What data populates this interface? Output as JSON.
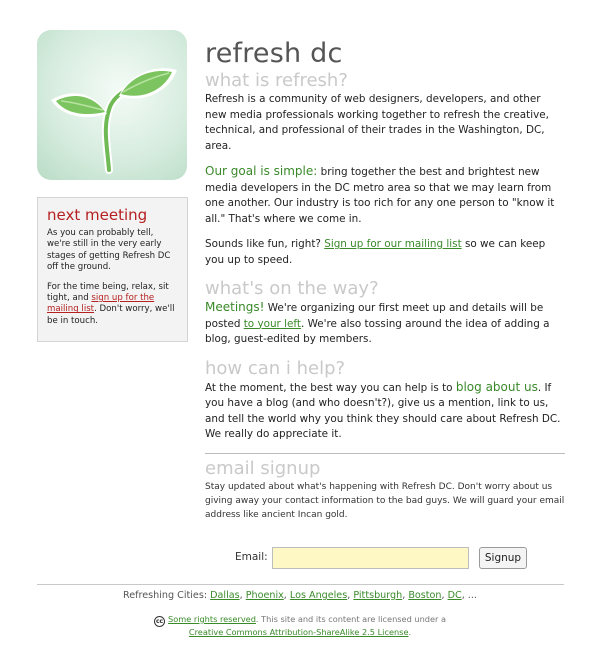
{
  "site": {
    "title": "refresh dc"
  },
  "sidebar": {
    "heading": "next meeting",
    "p1": "As you can probably tell, we're still in the very early stages of getting Refresh DC off the ground.",
    "p2_before": "For the time being, relax, sit tight, and ",
    "p2_link": "sign up for the mailing list",
    "p2_after": ". Don't worry, we'll be in touch."
  },
  "main": {
    "what_heading": "what is refresh?",
    "what_p": "Refresh is a community of web designers, developers, and other new media professionals working together to refresh the creative, technical, and professional of their trades in the Washington, DC, area.",
    "goal_lead": "Our goal is simple:",
    "goal_text": " bring together the best and brightest new media developers in the DC metro area so that we may learn from one another. Our industry is too rich for any one person to \"know it all.\" That's where we come in.",
    "fun_before": "Sounds like fun, right? ",
    "fun_link": "Sign up for our mailing list",
    "fun_after": " so we can keep you up to speed.",
    "way_heading": "what's on the way?",
    "way_lead": "Meetings!",
    "way_text1": " We're organizing our first meet up and details will be posted ",
    "way_link": "to your left",
    "way_text2": ". We're also tossing around the idea of adding a blog, guest-edited by members.",
    "help_heading": "how can i help?",
    "help_text1": "At the moment, the best way you can help is to ",
    "help_link": "blog about us",
    "help_text2": ". If you have a blog (and who doesn't?), give us a mention, link to us, and tell the world why you think they should care about Refresh DC. We really do appreciate it.",
    "email_heading": "email signup",
    "email_p": "Stay updated about what's happening with Refresh DC. Don't worry about us giving away your contact information to the bad guys. We will guard your email address like ancient Incan gold."
  },
  "signup": {
    "label": "Email:",
    "value": "",
    "button": "Signup"
  },
  "footer": {
    "cities_label": "Refreshing Cities:",
    "cities": [
      "Dallas",
      "Phoenix",
      "Los Angeles",
      "Pittsburgh",
      "Boston",
      "DC"
    ],
    "cities_more": "...",
    "cc_icon": "cc",
    "license_link": "Some rights reserved",
    "license_text": ". This site and its content are licensed under a",
    "license_name": "Creative Commons Attribution-ShareAlike 2.5 License",
    "license_end": "."
  },
  "colors": {
    "accent_green": "#3a8a2a",
    "heading_grey": "#c9c9c9",
    "sidebar_red": "#b52020",
    "input_yellow": "#fdf8c4"
  }
}
